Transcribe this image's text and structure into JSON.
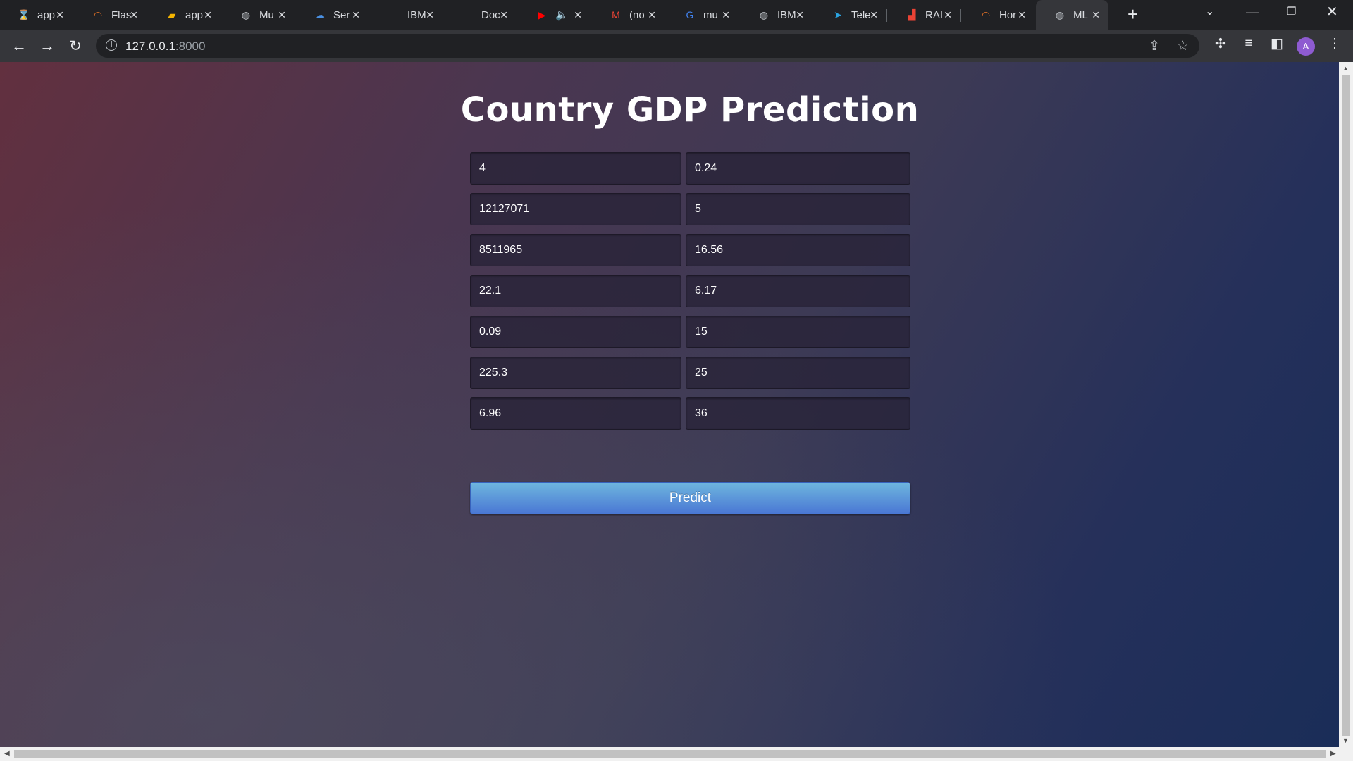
{
  "tabs": [
    {
      "icon": "hourglass-icon",
      "glyph": "⌛",
      "color": "#e8710a",
      "title": "app"
    },
    {
      "icon": "jupyter-icon",
      "glyph": "◠",
      "color": "#f37726",
      "title": "Flas"
    },
    {
      "icon": "notebook-icon",
      "glyph": "▰",
      "color": "#f4b400",
      "title": "app"
    },
    {
      "icon": "globe-icon",
      "glyph": "◍",
      "color": "#bdc1c6",
      "title": "Mu"
    },
    {
      "icon": "cloud-icon",
      "glyph": "☁",
      "color": "#4a90e2",
      "title": "Ser"
    },
    {
      "icon": "blank-icon",
      "glyph": "",
      "color": "#bdc1c6",
      "title": "IBM"
    },
    {
      "icon": "blank-icon",
      "glyph": "",
      "color": "#bdc1c6",
      "title": "Doc"
    },
    {
      "icon": "youtube-icon",
      "glyph": "▶",
      "color": "#ff0000",
      "title": "🔈"
    },
    {
      "icon": "gmail-icon",
      "glyph": "M",
      "color": "#ea4335",
      "title": "(no"
    },
    {
      "icon": "google-icon",
      "glyph": "G",
      "color": "#4285f4",
      "title": "mu"
    },
    {
      "icon": "globe-icon",
      "glyph": "◍",
      "color": "#bdc1c6",
      "title": "IBM"
    },
    {
      "icon": "telegram-icon",
      "glyph": "➤",
      "color": "#2aa3e0",
      "title": "Tele"
    },
    {
      "icon": "car-icon",
      "glyph": "▟",
      "color": "#ea4335",
      "title": "RAI"
    },
    {
      "icon": "jupyter-icon",
      "glyph": "◠",
      "color": "#f37726",
      "title": "Hor"
    },
    {
      "icon": "globe-icon",
      "glyph": "◍",
      "color": "#bdc1c6",
      "title": "ML"
    }
  ],
  "active_tab_index": 14,
  "address": {
    "host": "127.0.0.1",
    "port": ":8000"
  },
  "page": {
    "title": "Country GDP Prediction",
    "fields": [
      [
        "4",
        "0.24"
      ],
      [
        "12127071",
        "5"
      ],
      [
        "8511965",
        "16.56"
      ],
      [
        "22.1",
        "6.17"
      ],
      [
        "0.09",
        "15"
      ],
      [
        "225.3",
        "25"
      ],
      [
        "6.96",
        "36"
      ]
    ],
    "predict_label": "Predict"
  },
  "profile_initial": "A",
  "colors": {
    "predict_top": "#6eb6de",
    "predict_bottom": "#4a77d4",
    "avatar": "#8e5bd1"
  }
}
